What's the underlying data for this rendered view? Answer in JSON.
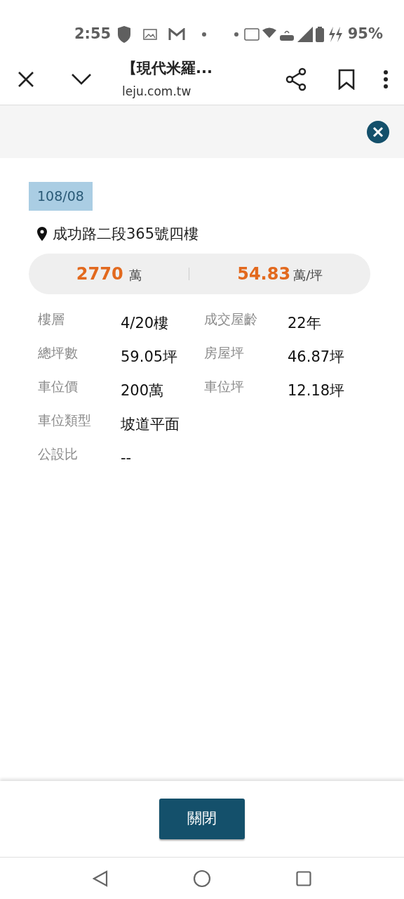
{
  "status_bar": {
    "time": "2:55",
    "battery": "95%"
  },
  "browser": {
    "title": "【現代米羅...",
    "url": "leju.com.tw"
  },
  "record": {
    "date": "108/08",
    "address": "成功路二段365號四樓",
    "price": {
      "total": "2770",
      "total_unit": "萬",
      "per_ping": "54.83",
      "per_ping_unit": "萬/坪"
    },
    "rows": [
      [
        {
          "label": "樓層",
          "value": "4/20樓"
        },
        {
          "label": "成交屋齡",
          "value": "22年"
        }
      ],
      [
        {
          "label": "總坪數",
          "value": "59.05坪"
        },
        {
          "label": "房屋坪",
          "value": "46.87坪"
        }
      ],
      [
        {
          "label": "車位價",
          "value": "200萬"
        },
        {
          "label": "車位坪",
          "value": "12.18坪"
        }
      ],
      [
        {
          "label": "車位類型",
          "value": "坡道平面"
        }
      ],
      [
        {
          "label": "公設比",
          "value": "--"
        }
      ]
    ]
  },
  "close_button": "關閉"
}
